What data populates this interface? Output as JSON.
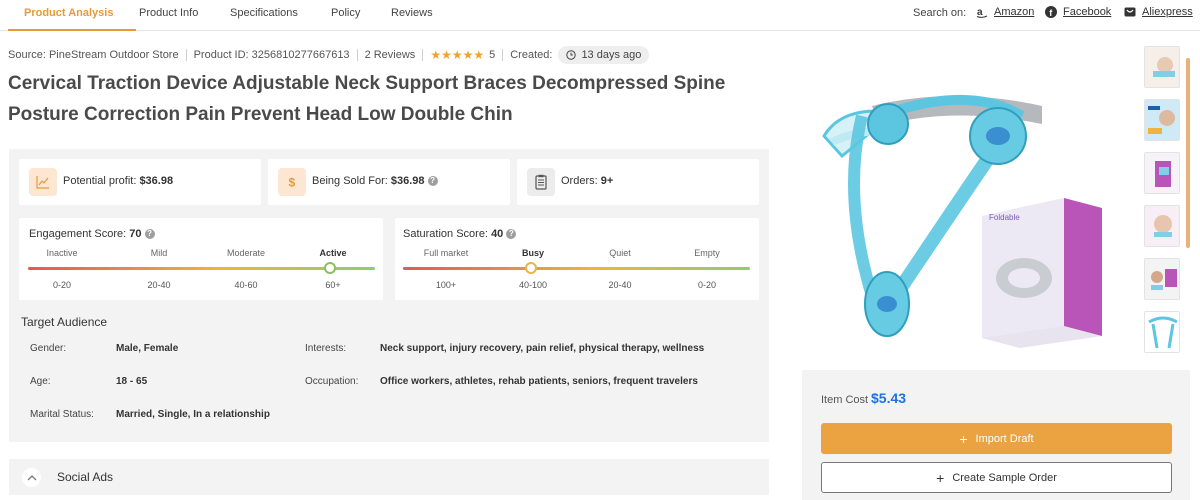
{
  "nav": {
    "tabs": [
      "Product Analysis",
      "Product Info",
      "Specifications",
      "Policy",
      "Reviews"
    ],
    "search_on_label": "Search on:",
    "links": [
      "Amazon",
      "Facebook",
      "Aliexpress"
    ]
  },
  "meta": {
    "source": "Source: PineStream Outdoor Store",
    "product_id": "Product ID: 3256810277667613",
    "reviews": "2 Reviews",
    "stars": "★★★★★",
    "rating": "5",
    "created_label": "Created:",
    "created_value": "13 days ago"
  },
  "title": "Cervical Traction Device Adjustable Neck Support Braces Decompressed Spine Posture Correction Pain Prevent Head Low Double Chin",
  "stats": {
    "profit_label": "Potential profit:",
    "profit_value": "$36.98",
    "sold_label": "Being Sold For:",
    "sold_value": "$36.98",
    "orders_label": "Orders:",
    "orders_value": "9+"
  },
  "engagement": {
    "label": "Engagement Score:",
    "value": "70",
    "levels": [
      "Inactive",
      "Mild",
      "Moderate",
      "Active"
    ],
    "ranges": [
      "0-20",
      "20-40",
      "40-60",
      "60+"
    ],
    "active_index": 3,
    "knob_fraction": 0.87
  },
  "saturation": {
    "label": "Saturation Score:",
    "value": "40",
    "levels": [
      "Full market",
      "Busy",
      "Quiet",
      "Empty"
    ],
    "ranges": [
      "100+",
      "40-100",
      "20-40",
      "0-20"
    ],
    "active_index": 1,
    "knob_fraction": 0.37
  },
  "audience": {
    "title": "Target Audience",
    "gender_label": "Gender:",
    "gender_value": "Male, Female",
    "age_label": "Age:",
    "age_value": "18 - 65",
    "marital_label": "Marital Status:",
    "marital_value": "Married, Single, In a relationship",
    "interests_label": "Interests:",
    "interests_value": "Neck support, injury recovery, pain relief, physical therapy, wellness",
    "occupation_label": "Occupation:",
    "occupation_value": "Office workers, athletes, rehab patients, seniors, frequent travelers"
  },
  "social_ads": "Social Ads",
  "box_label": "Foldable",
  "buy": {
    "cost_label": "Item Cost",
    "cost_value": "$5.43",
    "import_label": "Import Draft",
    "sample_label": "Create Sample Order"
  },
  "colors": {
    "accent": "#e79a3a",
    "price": "#1a73e8",
    "device": "#5cc6e0"
  }
}
